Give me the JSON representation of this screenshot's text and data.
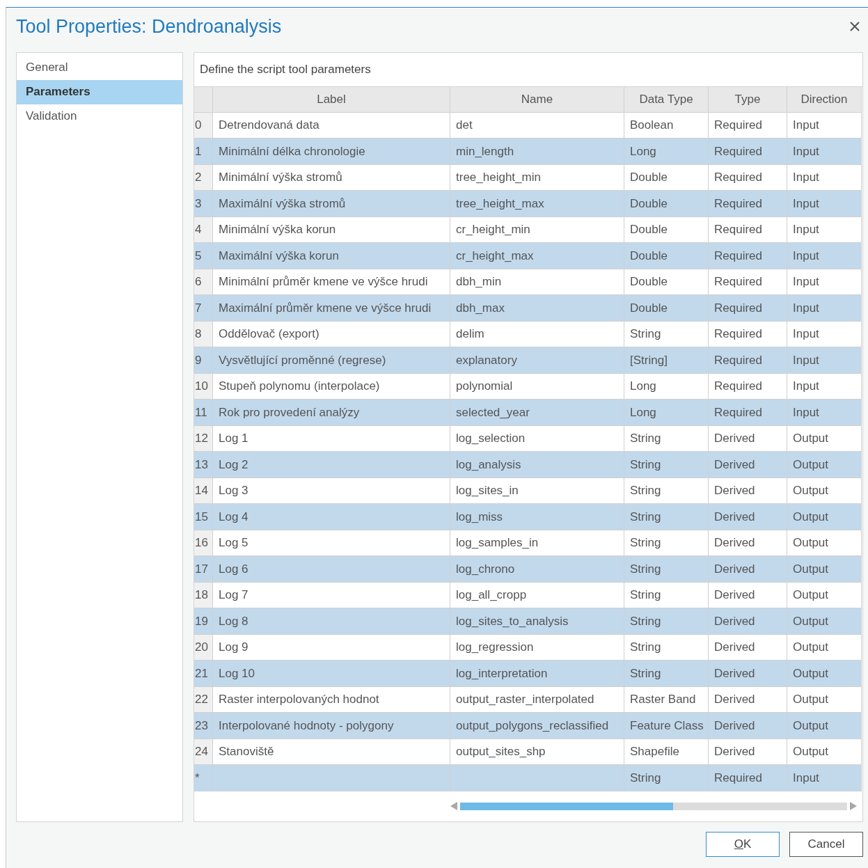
{
  "window": {
    "title": "Tool Properties: Dendroanalysis"
  },
  "sidebar": {
    "items": [
      {
        "label": "General",
        "selected": false
      },
      {
        "label": "Parameters",
        "selected": true
      },
      {
        "label": "Validation",
        "selected": false
      }
    ]
  },
  "panel": {
    "heading": "Define the script tool parameters"
  },
  "table": {
    "columns": [
      "Label",
      "Name",
      "Data Type",
      "Type",
      "Direction"
    ],
    "rows": [
      {
        "index": "0",
        "label": "Detrendovaná data",
        "name": "det",
        "data_type": "Boolean",
        "type": "Required",
        "direction": "Input"
      },
      {
        "index": "1",
        "label": "Minimální délka chronologie",
        "name": "min_length",
        "data_type": "Long",
        "type": "Required",
        "direction": "Input"
      },
      {
        "index": "2",
        "label": "Minimální výška stromů",
        "name": "tree_height_min",
        "data_type": "Double",
        "type": "Required",
        "direction": "Input"
      },
      {
        "index": "3",
        "label": "Maximální výška stromů",
        "name": "tree_height_max",
        "data_type": "Double",
        "type": "Required",
        "direction": "Input"
      },
      {
        "index": "4",
        "label": "Minimální výška korun",
        "name": "cr_height_min",
        "data_type": "Double",
        "type": "Required",
        "direction": "Input"
      },
      {
        "index": "5",
        "label": "Maximální výška korun",
        "name": "cr_height_max",
        "data_type": "Double",
        "type": "Required",
        "direction": "Input"
      },
      {
        "index": "6",
        "label": "Minimální průměr kmene ve výšce hrudi",
        "name": "dbh_min",
        "data_type": "Double",
        "type": "Required",
        "direction": "Input"
      },
      {
        "index": "7",
        "label": "Maximální průměr kmene ve výšce hrudi",
        "name": "dbh_max",
        "data_type": "Double",
        "type": "Required",
        "direction": "Input"
      },
      {
        "index": "8",
        "label": "Oddělovač (export)",
        "name": "delim",
        "data_type": "String",
        "type": "Required",
        "direction": "Input"
      },
      {
        "index": "9",
        "label": "Vysvětlující proměnné (regrese)",
        "name": "explanatory",
        "data_type": "[String]",
        "type": "Required",
        "direction": "Input"
      },
      {
        "index": "10",
        "label": "Stupeň polynomu (interpolace)",
        "name": "polynomial",
        "data_type": "Long",
        "type": "Required",
        "direction": "Input"
      },
      {
        "index": "11",
        "label": "Rok pro provedení analýzy",
        "name": "selected_year",
        "data_type": "Long",
        "type": "Required",
        "direction": "Input"
      },
      {
        "index": "12",
        "label": "Log 1",
        "name": "log_selection",
        "data_type": "String",
        "type": "Derived",
        "direction": "Output"
      },
      {
        "index": "13",
        "label": "Log 2",
        "name": "log_analysis",
        "data_type": "String",
        "type": "Derived",
        "direction": "Output"
      },
      {
        "index": "14",
        "label": "Log 3",
        "name": "log_sites_in",
        "data_type": "String",
        "type": "Derived",
        "direction": "Output"
      },
      {
        "index": "15",
        "label": "Log 4",
        "name": "log_miss",
        "data_type": "String",
        "type": "Derived",
        "direction": "Output"
      },
      {
        "index": "16",
        "label": "Log 5",
        "name": "log_samples_in",
        "data_type": "String",
        "type": "Derived",
        "direction": "Output"
      },
      {
        "index": "17",
        "label": "Log 6",
        "name": "log_chrono",
        "data_type": "String",
        "type": "Derived",
        "direction": "Output"
      },
      {
        "index": "18",
        "label": "Log 7",
        "name": "log_all_cropp",
        "data_type": "String",
        "type": "Derived",
        "direction": "Output"
      },
      {
        "index": "19",
        "label": "Log 8",
        "name": "log_sites_to_analysis",
        "data_type": "String",
        "type": "Derived",
        "direction": "Output"
      },
      {
        "index": "20",
        "label": "Log 9",
        "name": "log_regression",
        "data_type": "String",
        "type": "Derived",
        "direction": "Output"
      },
      {
        "index": "21",
        "label": "Log 10",
        "name": "log_interpretation",
        "data_type": "String",
        "type": "Derived",
        "direction": "Output"
      },
      {
        "index": "22",
        "label": "Raster interpolovaných hodnot",
        "name": "output_raster_interpolated",
        "data_type": "Raster Band",
        "type": "Derived",
        "direction": "Output"
      },
      {
        "index": "23",
        "label": "Interpolované hodnoty - polygony",
        "name": "output_polygons_reclassified",
        "data_type": "Feature Class",
        "type": "Derived",
        "direction": "Output"
      },
      {
        "index": "24",
        "label": "Stanoviště",
        "name": "output_sites_shp",
        "data_type": "Shapefile",
        "type": "Derived",
        "direction": "Output"
      },
      {
        "index": "*",
        "data_type": "String",
        "type": "Required",
        "direction": "Input"
      }
    ]
  },
  "buttons": [
    {
      "label": "OK",
      "default": true
    },
    {
      "label": "Cancel",
      "default": false
    }
  ]
}
